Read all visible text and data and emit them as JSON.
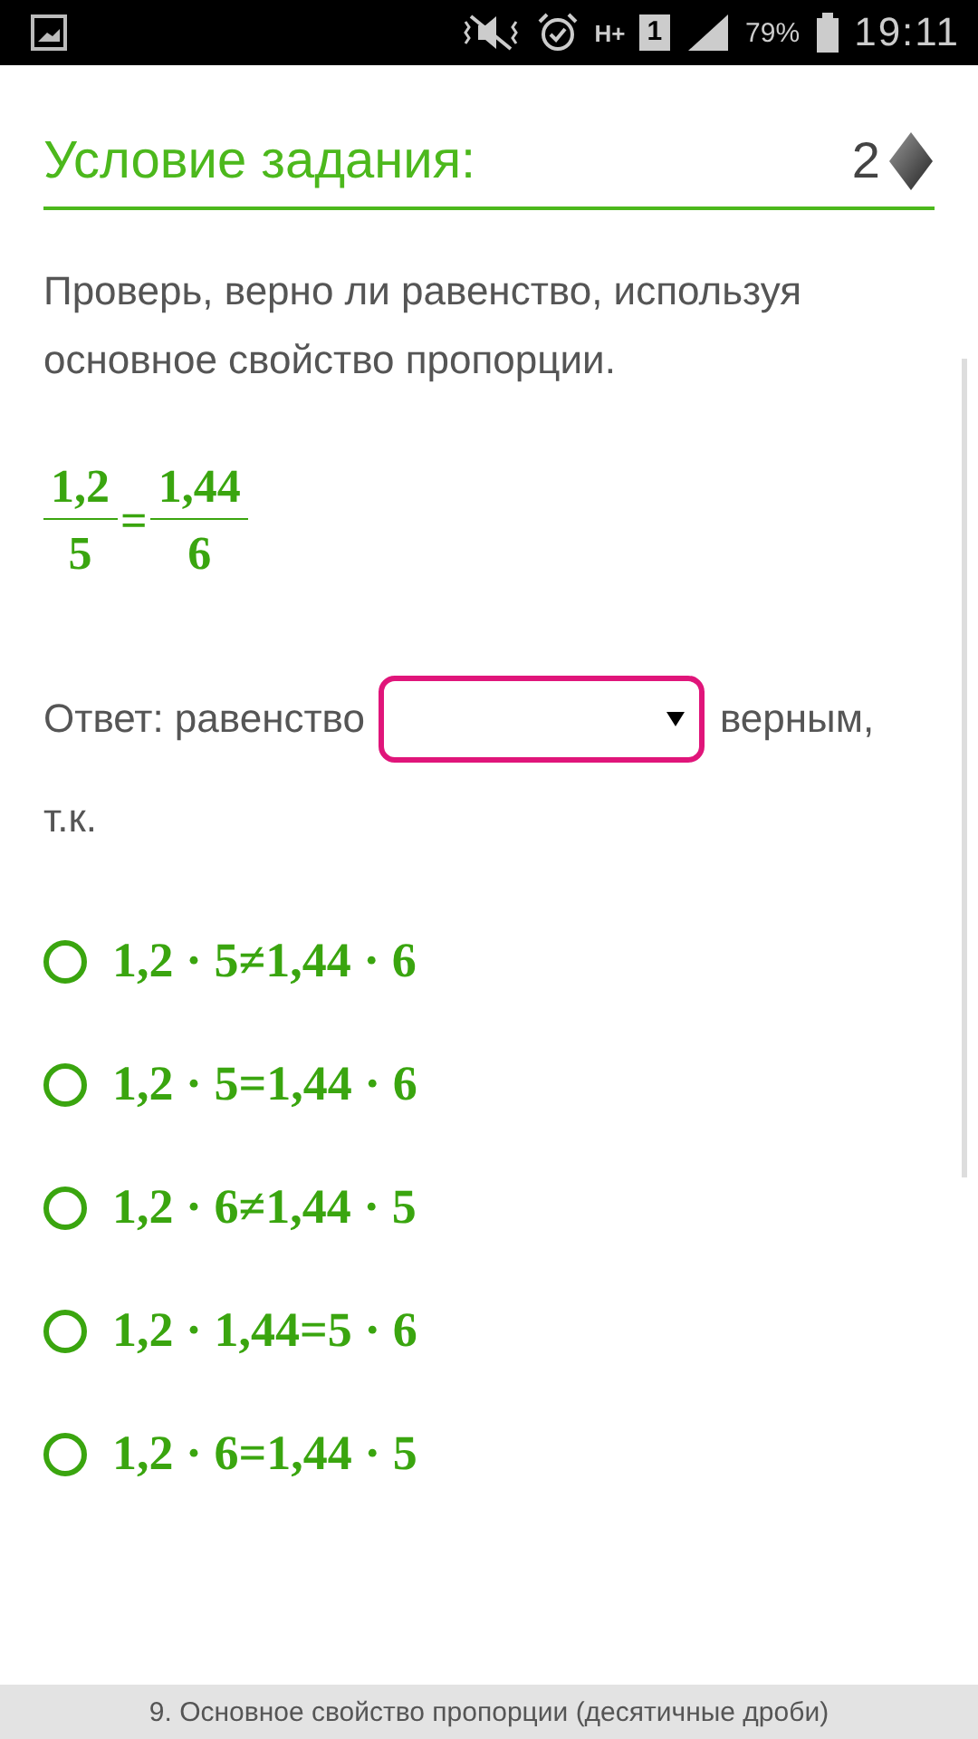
{
  "status_bar": {
    "network": "H+",
    "sim": "1",
    "battery": "79%",
    "time": "19:11"
  },
  "header": {
    "title": "Условие задания:",
    "points": "2"
  },
  "task": {
    "text": "Проверь, верно ли равенство, используя основное свойство пропорции.",
    "equation": {
      "left": {
        "numerator": "1,2",
        "denominator": "5"
      },
      "sign": "=",
      "right": {
        "numerator": "1,44",
        "denominator": "6"
      }
    }
  },
  "answer": {
    "prefix": "Ответ:  равенство",
    "suffix": "верным,",
    "continuation": "т.к."
  },
  "options": [
    {
      "text": "1,2 · 5≠1,44 · 6",
      "selected": false
    },
    {
      "text": "1,2 · 5=1,44 · 6",
      "selected": false
    },
    {
      "text": "1,2 · 6≠1,44 · 5",
      "selected": false
    },
    {
      "text": "1,2 · 1,44=5 · 6",
      "selected": false
    },
    {
      "text": "1,2 · 6=1,44 · 5",
      "selected": false
    }
  ],
  "footer": {
    "title": "9. Основное свойство пропорции (десятичные дроби)"
  }
}
